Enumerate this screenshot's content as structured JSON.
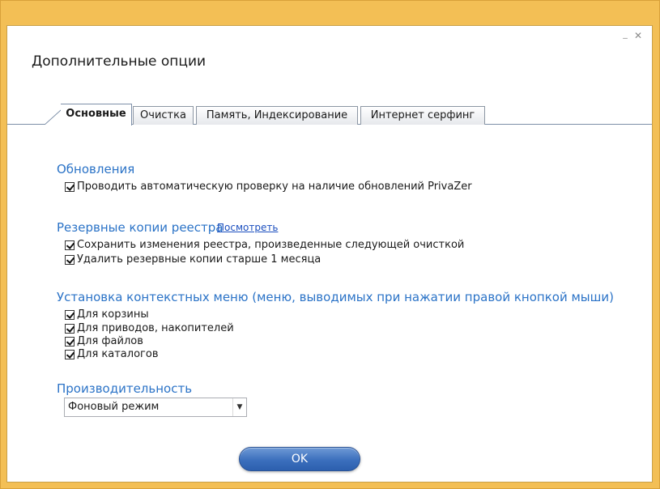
{
  "dialog": {
    "title": "Дополнительные опции",
    "window_controls": {
      "minimize": "_",
      "close": "✕"
    }
  },
  "tabs": [
    {
      "label": "Основные",
      "active": true
    },
    {
      "label": "Очистка",
      "active": false
    },
    {
      "label": "Память, Индексирование",
      "active": false
    },
    {
      "label": "Интернет серфинг",
      "active": false
    }
  ],
  "sections": {
    "updates": {
      "title": "Обновления",
      "options": [
        {
          "label": "Проводить автоматическую проверку на наличие обновлений PrivaZer",
          "checked": true
        }
      ]
    },
    "registry_backups": {
      "title": "Резервные копии реестра",
      "link": "Посмотреть",
      "options": [
        {
          "label": "Сохранить изменения реестра, произведенные следующей очисткой",
          "checked": true
        },
        {
          "label": "Удалить резервные копии старше 1 месяца",
          "checked": true
        }
      ]
    },
    "context_menu": {
      "title": "Установка контекстных меню (меню, выводимых при нажатии правой кнопкой мыши)",
      "options": [
        {
          "label": "Для корзины",
          "checked": true
        },
        {
          "label": "Для приводов, накопителей",
          "checked": true
        },
        {
          "label": "Для файлов",
          "checked": true
        },
        {
          "label": "Для каталогов",
          "checked": true
        }
      ]
    },
    "performance": {
      "title": "Производительность",
      "selected": "Фоновый режим"
    }
  },
  "buttons": {
    "ok": "OK"
  },
  "colors": {
    "accent": "#2b73c7",
    "frame": "#f3bf55",
    "button": "#3b6fbd"
  }
}
